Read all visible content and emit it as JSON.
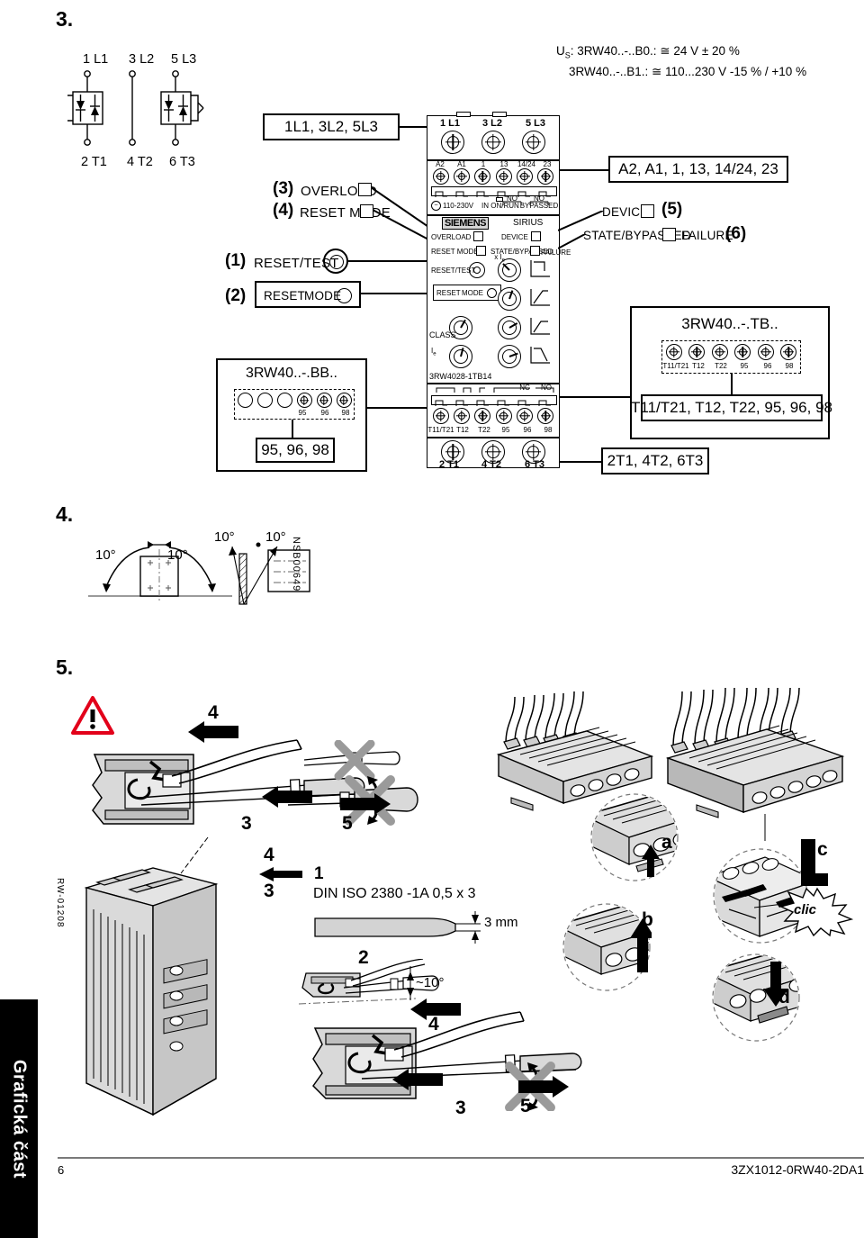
{
  "page": {
    "number": "6",
    "doc_number": "3ZX1012-0RW40-2DA1",
    "side_tab": "Grafická část",
    "drawing_code_left": "RW-01208",
    "drawing_code_sec4": "NSB00649"
  },
  "sections": {
    "three": "3.",
    "four": "4.",
    "five": "5."
  },
  "supply": {
    "line1": "U : 3RW40..-..B0.: ≅ 24 V ± 20 %",
    "line1_prefix": "U",
    "line1_sub": "S",
    "line1_rest": ": 3RW40..-..B0.: ≅ 24 V ± 20 %",
    "line2": "3RW40..-..B1.: ≅ 110...230 V -15 % / +10 %"
  },
  "schematic": {
    "top_labels": [
      "1 L1",
      "3 L2",
      "5 L3"
    ],
    "bottom_labels": [
      "2 T1",
      "4 T2",
      "6 T3"
    ]
  },
  "callouts": {
    "mains_box": "1L1, 3L2, 5L3",
    "control_box": "A2, A1, 1, 13, 14/24, 23",
    "output_box": "2T1, 4T2, 6T3",
    "item1_num": "(1)",
    "item1_label": "RESET/TEST",
    "item2_num": "(2)",
    "item2_label_a": "RESET",
    "item2_label_b": "MODE",
    "item3_num": "(3)",
    "item3_label": "OVERLOAD",
    "item4_num": "(4)",
    "item4_label": "RESET MODE",
    "item5_num": "(5)",
    "item5_label": "DEVICE",
    "item6_num": "(6)",
    "item6_label_a": "STATE/BYPASSED",
    "item6_label_b": "FAILURE"
  },
  "variant_bb": {
    "title": "3RW40..-.BB..",
    "terminal_labels": [
      "",
      "",
      "",
      "95",
      "96",
      "98"
    ],
    "result_box": "95, 96, 98"
  },
  "variant_tb": {
    "title": "3RW40..-.TB..",
    "terminal_labels": [
      "T11/T21",
      "T12",
      "T22",
      "95",
      "96",
      "98"
    ],
    "result_box": "T11/T21, T12, T22, 95, 96, 98"
  },
  "device": {
    "top_terminals": [
      "1 L1",
      "3 L2",
      "5 L3"
    ],
    "control_terminals": [
      "A2",
      "A1",
      "1",
      "13",
      "14/24",
      "23"
    ],
    "legend_voltage": "110-230V",
    "legend_in": "IN",
    "legend_onrun": "ON/RUN",
    "legend_bypassed": "BYPASSED",
    "legend_no": "NO",
    "brand": "SIEMENS",
    "family": "SIRIUS",
    "led_overload": "OVERLOAD",
    "led_device": "DEVICE",
    "led_reset_mode": "RESET MODE",
    "led_state_bypassed": "STATE/BYPASSED",
    "led_failure": "FAILURE",
    "reset_test": "RESET/TEST",
    "reset_mode_a": "RESET",
    "reset_mode_b": "MODE",
    "class_label": "CLASS",
    "current_label": "I",
    "knob_ie": "x I",
    "model": "3RW4028-1TB14",
    "contact_nc": "NC",
    "contact_no": "NO",
    "bottom_aux_terminals": [
      "T11/T21",
      "T12",
      "T22",
      "95",
      "96",
      "98"
    ],
    "bottom_terminals": [
      "2 T1",
      "4 T2",
      "6 T3"
    ]
  },
  "section4": {
    "angles": [
      "10°",
      "10°",
      "10°",
      "10°"
    ]
  },
  "section5": {
    "steps": [
      "1",
      "2",
      "3",
      "4",
      "5"
    ],
    "step3_a": "3",
    "step4_a": "4",
    "step5_a": "5",
    "step3_b": "3",
    "step4_b": "4",
    "step5_b": "5",
    "screwdriver_spec": "DIN ISO 2380 -1A 0,5 x 3",
    "screwdriver_width": "3 mm",
    "insert_angle": "~10°",
    "detail_a": "a",
    "detail_b": "b",
    "detail_c": "c",
    "detail_d": "d",
    "click_text": "clic"
  },
  "colors": {
    "warning_red": "#e2001a",
    "gray_fill": "#d9d9d9",
    "gray_dark": "#b5b5b5",
    "rule": "#7a7a7a"
  }
}
